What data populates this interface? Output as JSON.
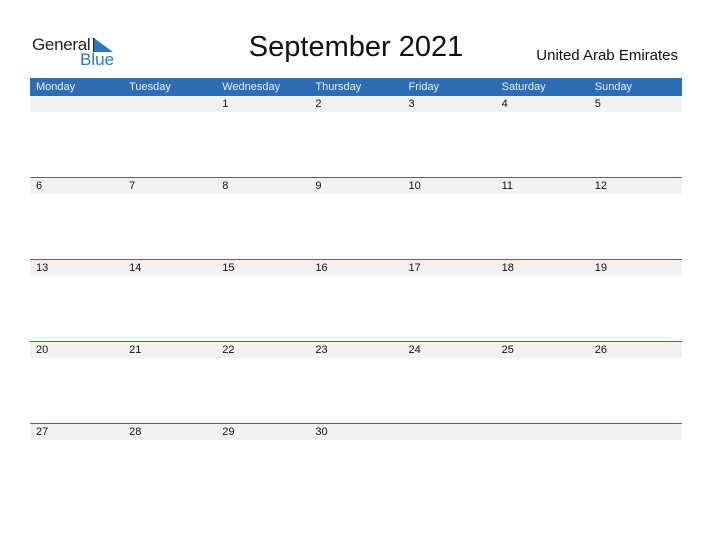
{
  "logo": {
    "line1": "General",
    "line2": "Blue"
  },
  "title": "September 2021",
  "country": "United Arab Emirates",
  "colors": {
    "header": "#2e6db4",
    "accent": "#2a78c6",
    "row_strip": "#f2f2f2"
  },
  "weekdays": [
    "Monday",
    "Tuesday",
    "Wednesday",
    "Thursday",
    "Friday",
    "Saturday",
    "Sunday"
  ],
  "weeks": [
    [
      "",
      "",
      "1",
      "2",
      "3",
      "4",
      "5"
    ],
    [
      "6",
      "7",
      "8",
      "9",
      "10",
      "11",
      "12"
    ],
    [
      "13",
      "14",
      "15",
      "16",
      "17",
      "18",
      "19"
    ],
    [
      "20",
      "21",
      "22",
      "23",
      "24",
      "25",
      "26"
    ],
    [
      "27",
      "28",
      "29",
      "30",
      "",
      "",
      ""
    ]
  ]
}
